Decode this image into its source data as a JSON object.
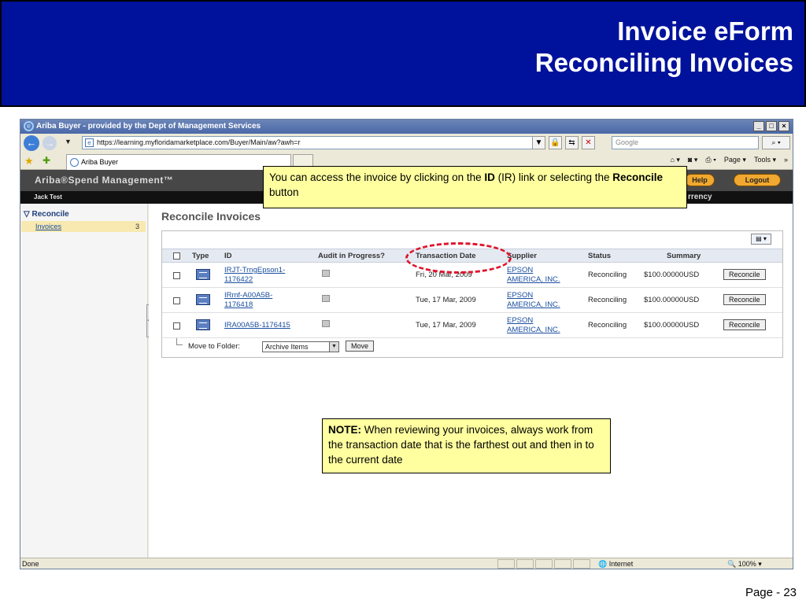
{
  "slide": {
    "title_line1": "Invoice eForm",
    "title_line2": "Reconciling Invoices",
    "page": "Page - 23"
  },
  "browser": {
    "window_title": "Ariba Buyer - provided by the Dept of Management Services",
    "url": "https://learning.myfloridamarketplace.com/Buyer/Main/aw?awh=r",
    "search_placeholder": "Google",
    "tab_title": "Ariba Buyer",
    "cmd_page": "Page",
    "cmd_tools": "Tools",
    "status_left": "Done",
    "status_zone": "Internet",
    "status_zoom": "100%"
  },
  "app": {
    "logo": "Ariba®Spend Management™",
    "help_label": "Help",
    "logout_label": "Logout",
    "user": "Jack Test",
    "userbar_right": "rrency",
    "sidebar": {
      "section": "Reconcile",
      "item_label": "Invoices",
      "item_count": "3"
    },
    "page_title": "Reconcile Invoices",
    "columns": [
      "Type",
      "ID",
      "Audit in Progress?",
      "Transaction Date",
      "Supplier",
      "Status",
      "Summary"
    ],
    "rows": [
      {
        "id_line1": "IRJT-TrngEpson1-",
        "id_line2": "1176422",
        "date": "Fri, 20 Mar, 2009",
        "supplier_line1": "EPSON",
        "supplier_line2": "AMERICA, INC.",
        "status": "Reconciling",
        "summary": "$100.00000USD",
        "action": "Reconcile"
      },
      {
        "id_line1": "IRmf-A00A5B-",
        "id_line2": "1176418",
        "date": "Tue, 17 Mar, 2009",
        "supplier_line1": "EPSON",
        "supplier_line2": "AMERICA, INC.",
        "status": "Reconciling",
        "summary": "$100.00000USD",
        "action": "Reconcile"
      },
      {
        "id_line1": "IRA00A5B-1176415",
        "id_line2": "",
        "date": "Tue, 17 Mar, 2009",
        "supplier_line1": "EPSON",
        "supplier_line2": "AMERICA, INC.",
        "status": "Reconciling",
        "summary": "$100.00000USD",
        "action": "Reconcile"
      }
    ],
    "move_label": "Move to Folder:",
    "folder_selected": "Archive Items",
    "move_button": "Move"
  },
  "callouts": {
    "c1_text1": "You can access the invoice by clicking on the ",
    "c1_bold1": "ID",
    "c1_text2": " (IR) link or selecting the ",
    "c1_bold2": "Reconcile",
    "c1_text3": " button",
    "c2_bold": "NOTE:",
    "c2_text": " When reviewing your invoices, always work from the transaction date that is the farthest out and then in to the current date"
  },
  "colors": {
    "slide_header": "#00129b",
    "callout_bg": "#ffffa0",
    "highlight_oval": "#e0142c",
    "ariba_button": "#f0a830"
  }
}
